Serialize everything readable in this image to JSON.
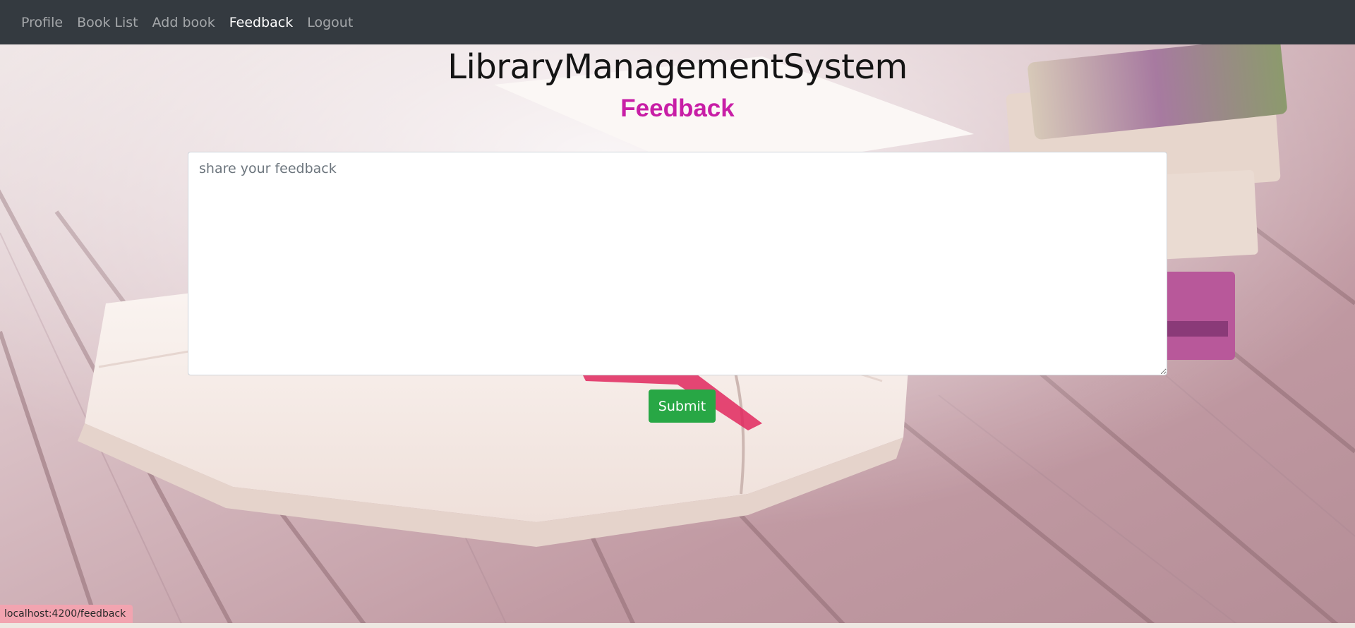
{
  "nav": {
    "items": [
      {
        "label": "Profile",
        "active": false
      },
      {
        "label": "Book List",
        "active": false
      },
      {
        "label": "Add book",
        "active": false
      },
      {
        "label": "Feedback",
        "active": true
      },
      {
        "label": "Logout",
        "active": false
      }
    ]
  },
  "header": {
    "app_title": "LibraryManagementSystem",
    "page_title": "Feedback"
  },
  "form": {
    "feedback_placeholder": "share your feedback",
    "feedback_value": "",
    "submit_label": "Submit"
  },
  "status_bar": {
    "url": "localhost:4200/feedback"
  },
  "colors": {
    "navbar_bg": "#343a40",
    "page_title": "#c81ea6",
    "submit_bg": "#28a745"
  }
}
